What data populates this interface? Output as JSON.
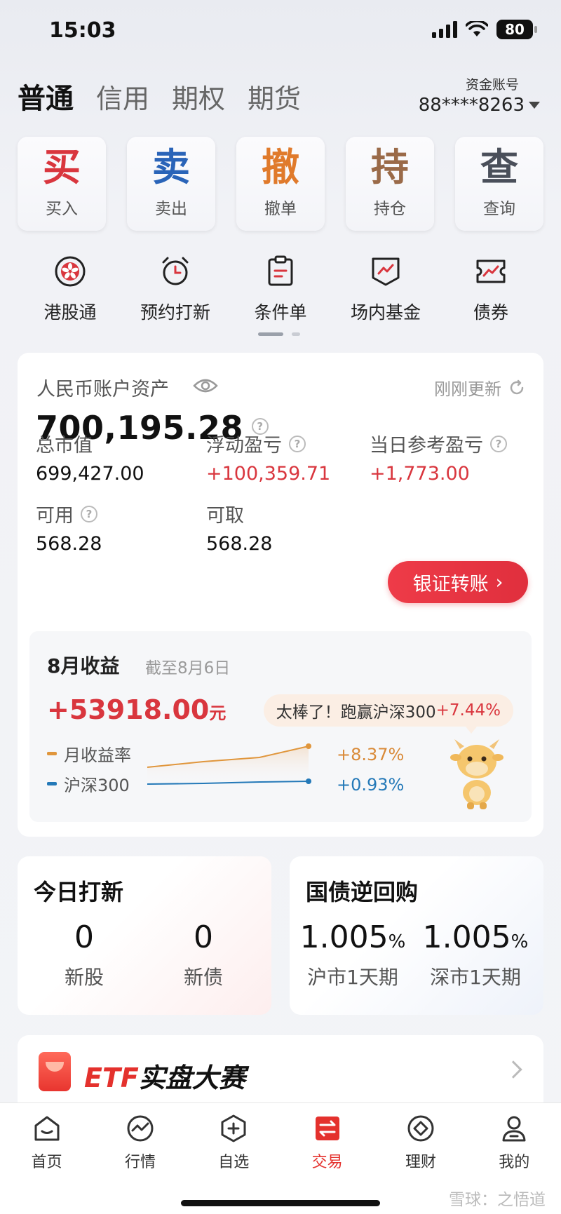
{
  "status": {
    "time": "15:03",
    "battery": "80"
  },
  "account_tabs": [
    {
      "label": "普通",
      "active": true
    },
    {
      "label": "信用",
      "active": false
    },
    {
      "label": "期权",
      "active": false
    },
    {
      "label": "期货",
      "active": false
    }
  ],
  "fund_account": {
    "label": "资金账号",
    "number": "88****8263"
  },
  "tiles": [
    {
      "char": "买",
      "label": "买入",
      "color": "#d9363e"
    },
    {
      "char": "卖",
      "label": "卖出",
      "color": "#2a64b8"
    },
    {
      "char": "撤",
      "label": "撤单",
      "color": "#e07a2b"
    },
    {
      "char": "持",
      "label": "持仓",
      "color": "#9a6a48"
    },
    {
      "char": "查",
      "label": "查询",
      "color": "#4a4f5a"
    }
  ],
  "shortcuts": [
    {
      "label": "港股通",
      "icon": "hk-connect-icon"
    },
    {
      "label": "预约打新",
      "icon": "alarm-clock-icon"
    },
    {
      "label": "条件单",
      "icon": "clipboard-icon"
    },
    {
      "label": "场内基金",
      "icon": "fund-chart-icon"
    },
    {
      "label": "债券",
      "icon": "bond-ticket-icon"
    }
  ],
  "assets": {
    "title": "人民币账户资产",
    "updated": "刚刚更新",
    "total": "700,195.28",
    "market_value_label": "总市值",
    "market_value": "699,427.00",
    "floating_pl_label": "浮动盈亏",
    "floating_pl": "+100,359.71",
    "today_pl_label": "当日参考盈亏",
    "today_pl": "+1,773.00",
    "available_label": "可用",
    "available": "568.28",
    "withdrawable_label": "可取",
    "withdrawable": "568.28",
    "transfer_label": "银证转账"
  },
  "earnings": {
    "title": "8月收益",
    "as_of": "截至8月6日",
    "amount": "+53918.00",
    "unit": "元",
    "bubble_text": "太棒了！跑赢沪深300",
    "bubble_pct": "+7.44%",
    "legend_monthly": "月收益率",
    "legend_index": "沪深300",
    "monthly_value": "+8.37%",
    "index_value": "+0.93%",
    "color_monthly": "#e0963c",
    "color_index": "#2479b8"
  },
  "ipo": {
    "title": "今日打新",
    "stocks_count": "0",
    "stocks_label": "新股",
    "bonds_count": "0",
    "bonds_label": "新债"
  },
  "repo": {
    "title": "国债逆回购",
    "sh_rate": "1.005",
    "sh_label": "沪市1天期",
    "sz_rate": "1.005",
    "sz_label": "深市1天期",
    "pct_sign": "%"
  },
  "banner": {
    "etf": "ETF",
    "text": "实盘大赛"
  },
  "nav": [
    {
      "label": "首页",
      "icon": "home-icon",
      "active": false
    },
    {
      "label": "行情",
      "icon": "market-icon",
      "active": false
    },
    {
      "label": "自选",
      "icon": "watchlist-icon",
      "active": false
    },
    {
      "label": "交易",
      "icon": "trade-icon",
      "active": true
    },
    {
      "label": "理财",
      "icon": "wealth-icon",
      "active": false
    },
    {
      "label": "我的",
      "icon": "profile-icon",
      "active": false
    }
  ],
  "watermark": "雪球：之悟道"
}
